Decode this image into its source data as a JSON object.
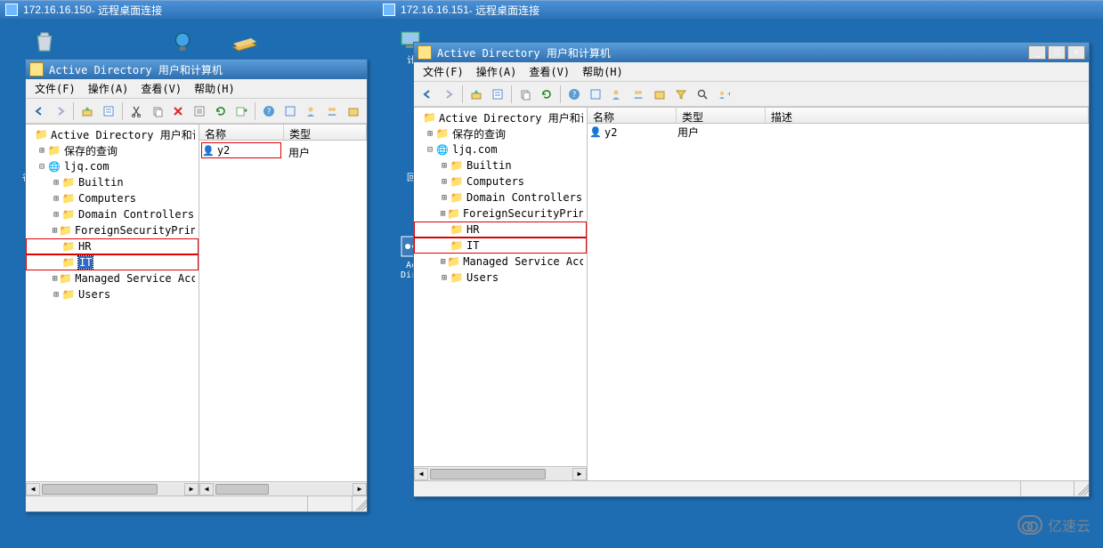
{
  "watermark": "亿速云",
  "rdc": [
    {
      "ip": "172.16.16.150",
      "suffix": " - 远程桌面连接"
    },
    {
      "ip": "172.16.16.151",
      "suffix": " - 远程桌面连接"
    }
  ],
  "ad_window": {
    "title": "Active Directory 用户和计算机",
    "menus": {
      "file": "文件(F)",
      "action": "操作(A)",
      "view": "查看(V)",
      "help": "帮助(H)"
    },
    "tree": {
      "root": "Active Directory 用户和计算机",
      "saved": "保存的查询",
      "domain": "ljq.com",
      "nodes": {
        "builtin": "Builtin",
        "computers": "Computers",
        "dc": "Domain Controllers",
        "fsp": "ForeignSecurityPrincipals",
        "hr": "HR",
        "it": "IT",
        "msa": "Managed Service Accounts",
        "users": "Users"
      }
    },
    "columns": {
      "name": "名称",
      "type": "类型",
      "desc": "描述"
    },
    "list": {
      "user": {
        "name": "y2",
        "type": "用户"
      }
    },
    "win_btns": {
      "min": "_",
      "max": "□",
      "close": "×"
    }
  },
  "desktop_labels": {
    "trash_char": "🗑",
    "globe_char": "🌐",
    "book_char": "📒",
    "computer_char": "🖥",
    "ac": "Ac",
    "dire": "Dire",
    "ji": "计",
    "hui": "回",
    "gu": "谷"
  }
}
